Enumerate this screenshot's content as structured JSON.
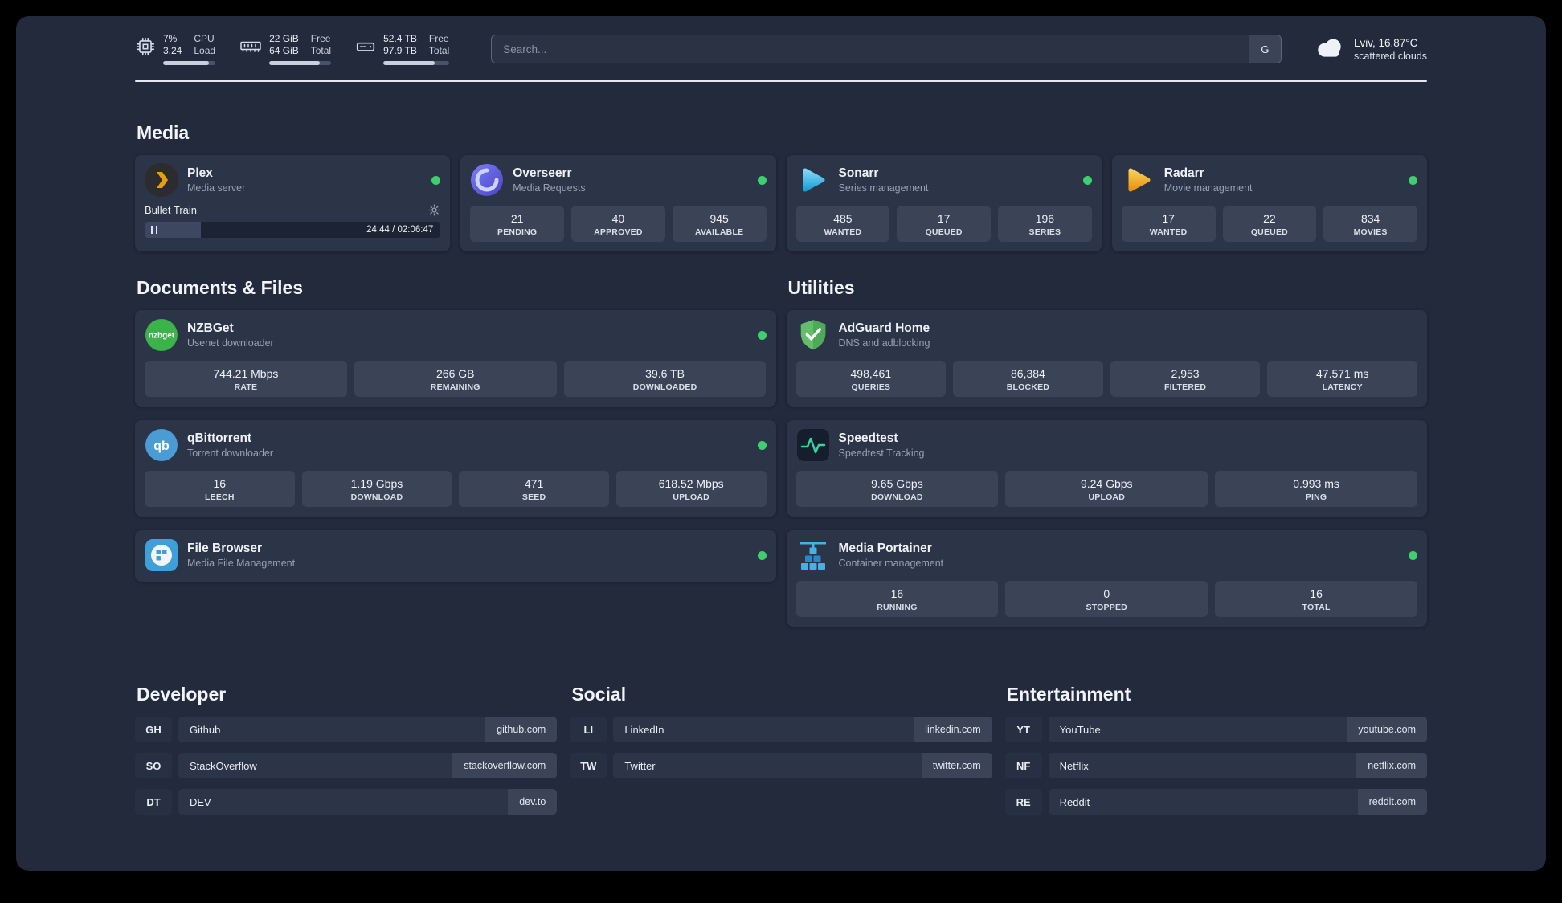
{
  "topbar": {
    "cpu": {
      "line1": "7%",
      "line2": "3.24",
      "label1": "CPU",
      "label2": "Load",
      "bar_percent": 88
    },
    "ram": {
      "line1": "22 GiB",
      "line2": "64 GiB",
      "label1": "Free",
      "label2": "Total",
      "bar_percent": 82
    },
    "disk": {
      "line1": "52.4 TB",
      "line2": "97.9 TB",
      "label1": "Free",
      "label2": "Total",
      "bar_percent": 78
    },
    "search": {
      "placeholder": "Search...",
      "button_label": "G"
    },
    "weather": {
      "location": "Lviv, 16.87°C",
      "condition": "scattered clouds"
    }
  },
  "sections": {
    "media": {
      "title": "Media",
      "plex": {
        "name": "Plex",
        "subtitle": "Media server",
        "now_playing": "Bullet Train",
        "time": "24:44 / 02:06:47",
        "progress_percent": 19
      },
      "overseerr": {
        "name": "Overseerr",
        "subtitle": "Media Requests",
        "stats": [
          {
            "value": "21",
            "label": "PENDING"
          },
          {
            "value": "40",
            "label": "APPROVED"
          },
          {
            "value": "945",
            "label": "AVAILABLE"
          }
        ]
      },
      "sonarr": {
        "name": "Sonarr",
        "subtitle": "Series management",
        "stats": [
          {
            "value": "485",
            "label": "WANTED"
          },
          {
            "value": "17",
            "label": "QUEUED"
          },
          {
            "value": "196",
            "label": "SERIES"
          }
        ]
      },
      "radarr": {
        "name": "Radarr",
        "subtitle": "Movie management",
        "stats": [
          {
            "value": "17",
            "label": "WANTED"
          },
          {
            "value": "22",
            "label": "QUEUED"
          },
          {
            "value": "834",
            "label": "MOVIES"
          }
        ]
      }
    },
    "documents": {
      "title": "Documents & Files",
      "nzbget": {
        "name": "NZBGet",
        "subtitle": "Usenet downloader",
        "stats": [
          {
            "value": "744.21 Mbps",
            "label": "RATE"
          },
          {
            "value": "266 GB",
            "label": "REMAINING"
          },
          {
            "value": "39.6 TB",
            "label": "DOWNLOADED"
          }
        ]
      },
      "qbittorrent": {
        "name": "qBittorrent",
        "subtitle": "Torrent downloader",
        "stats": [
          {
            "value": "16",
            "label": "LEECH"
          },
          {
            "value": "1.19 Gbps",
            "label": "DOWNLOAD"
          },
          {
            "value": "471",
            "label": "SEED"
          },
          {
            "value": "618.52 Mbps",
            "label": "UPLOAD"
          }
        ]
      },
      "filebrowser": {
        "name": "File Browser",
        "subtitle": "Media File Management"
      }
    },
    "utilities": {
      "title": "Utilities",
      "adguard": {
        "name": "AdGuard Home",
        "subtitle": "DNS and adblocking",
        "stats": [
          {
            "value": "498,461",
            "label": "QUERIES"
          },
          {
            "value": "86,384",
            "label": "BLOCKED"
          },
          {
            "value": "2,953",
            "label": "FILTERED"
          },
          {
            "value": "47.571 ms",
            "label": "LATENCY"
          }
        ]
      },
      "speedtest": {
        "name": "Speedtest",
        "subtitle": "Speedtest Tracking",
        "stats": [
          {
            "value": "9.65 Gbps",
            "label": "DOWNLOAD"
          },
          {
            "value": "9.24 Gbps",
            "label": "UPLOAD"
          },
          {
            "value": "0.993 ms",
            "label": "PING"
          }
        ]
      },
      "portainer": {
        "name": "Media Portainer",
        "subtitle": "Container management",
        "stats": [
          {
            "value": "16",
            "label": "RUNNING"
          },
          {
            "value": "0",
            "label": "STOPPED"
          },
          {
            "value": "16",
            "label": "TOTAL"
          }
        ]
      }
    },
    "bookmarks": [
      {
        "title": "Developer",
        "items": [
          {
            "abbr": "GH",
            "name": "Github",
            "url": "github.com"
          },
          {
            "abbr": "SO",
            "name": "StackOverflow",
            "url": "stackoverflow.com"
          },
          {
            "abbr": "DT",
            "name": "DEV",
            "url": "dev.to"
          }
        ]
      },
      {
        "title": "Social",
        "items": [
          {
            "abbr": "LI",
            "name": "LinkedIn",
            "url": "linkedin.com"
          },
          {
            "abbr": "TW",
            "name": "Twitter",
            "url": "twitter.com"
          }
        ]
      },
      {
        "title": "Entertainment",
        "items": [
          {
            "abbr": "YT",
            "name": "YouTube",
            "url": "youtube.com"
          },
          {
            "abbr": "NF",
            "name": "Netflix",
            "url": "netflix.com"
          },
          {
            "abbr": "RE",
            "name": "Reddit",
            "url": "reddit.com"
          }
        ]
      }
    ]
  },
  "colors": {
    "status_online": "#3ecf6e",
    "accent_plex": "#e5a00d"
  }
}
